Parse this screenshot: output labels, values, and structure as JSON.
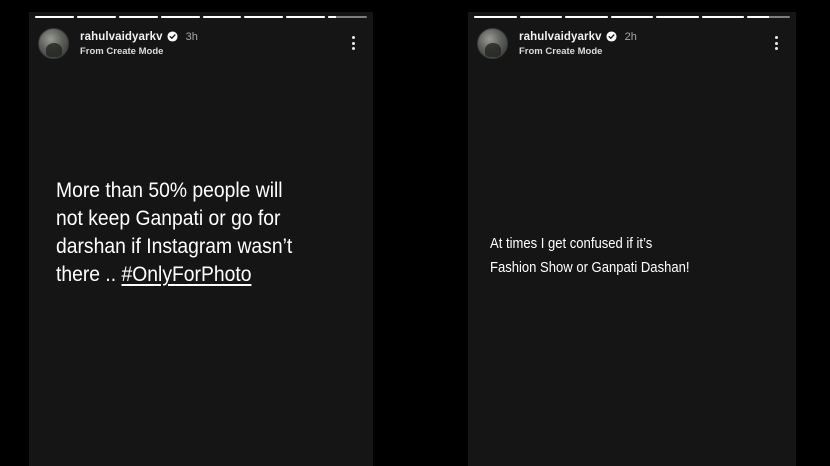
{
  "colors": {
    "background": "#000000",
    "story_background": "#151515",
    "text": "#ffffff",
    "timestamp": "#a8a8a8"
  },
  "stories": [
    {
      "progress": [
        1,
        1,
        1,
        1,
        1,
        1,
        1,
        0.2
      ],
      "username": "rahulvaidyarkv",
      "verified_icon": "verified-badge-icon",
      "time": "3h",
      "subtitle": "From Create Mode",
      "more_icon": "more-vertical-icon",
      "text_line1": "More than 50% people will",
      "text_line2": "not keep Ganpati or go for",
      "text_line3": "darshan if Instagram wasn’t",
      "text_line4_prefix": "there .. ",
      "hashtag": "#OnlyForPhoto"
    },
    {
      "progress": [
        1,
        1,
        1,
        1,
        1,
        1,
        0.5
      ],
      "username": "rahulvaidyarkv",
      "verified_icon": "verified-badge-icon",
      "time": "2h",
      "subtitle": "From Create Mode",
      "more_icon": "more-vertical-icon",
      "text_line1": "At times I get confused if it’s",
      "text_line2": "Fashion Show or Ganpati Dashan!"
    }
  ]
}
